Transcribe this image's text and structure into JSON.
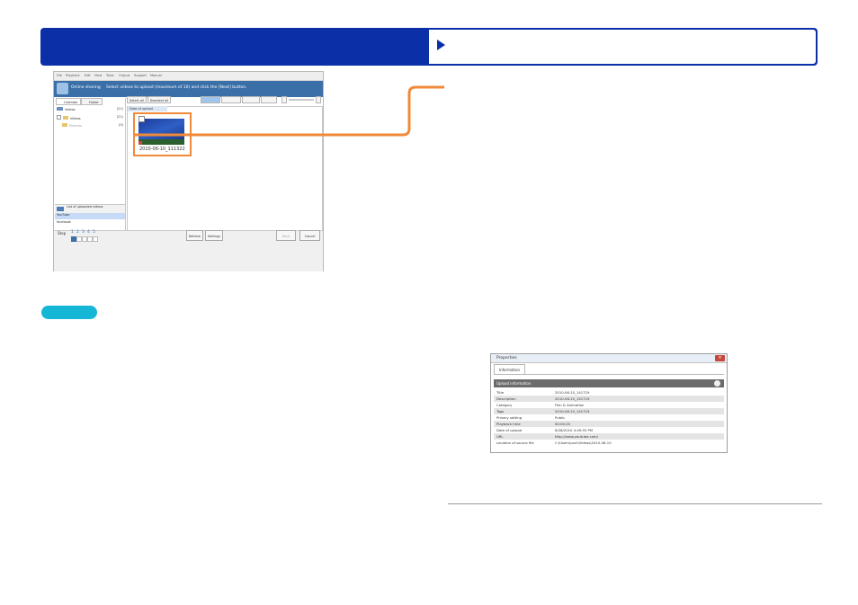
{
  "app": {
    "menu": [
      "File",
      "Playback",
      "Edit",
      "View",
      "Tools",
      "Output",
      "Support",
      "Manual"
    ],
    "banner_title": "Online sharing",
    "banner_instruction": "Select videos to upload (maximum of 10) and click the [Next] button.",
    "tabs": [
      "Calendar",
      "Folder"
    ],
    "tree": [
      {
        "label": "Videos",
        "count": "(21)"
      },
      {
        "label": "Videos",
        "count": "(21)"
      },
      {
        "label": "Pictures",
        "count": "(0)"
      }
    ],
    "services_header": "List of uploaded videos",
    "services": [
      "YouTube",
      "facebook"
    ],
    "toolbar_buttons": [
      "Select all",
      "Deselect all"
    ],
    "sort_label": "Date of upload",
    "thumbnail_label": "2010-06-10_111322",
    "step_label": "Step",
    "steps": [
      "1",
      "2",
      "3",
      "4",
      "5"
    ],
    "buttons": {
      "refresh": "Refresh",
      "settings": "Settings",
      "back": "Back",
      "cancel": "Cancel"
    }
  },
  "dialog": {
    "title": "Properties",
    "tab": "Information",
    "section": "Upload information",
    "rows": [
      {
        "key": "Title",
        "value": "2010-06-10_141719"
      },
      {
        "key": "Description",
        "value": "2010-06-10_141719"
      },
      {
        "key": "Category",
        "value": "Film & Animation"
      },
      {
        "key": "Tags",
        "value": "2010-06-10_141719"
      },
      {
        "key": "Privacy setting",
        "value": "Public"
      },
      {
        "key": "Playback time",
        "value": "00:00:20"
      },
      {
        "key": "Date of upload",
        "value": "6/28/2010 4:49:55 PM"
      },
      {
        "key": "URL",
        "value": "http://www.youtube.com/"
      },
      {
        "key": "Location of source file",
        "value": "C:\\Users\\user\\Videos\\2010-06-10"
      }
    ]
  },
  "colors": {
    "header": "#0a2fa6",
    "pill": "#16b7d6",
    "highlight": "#f08a3a"
  }
}
